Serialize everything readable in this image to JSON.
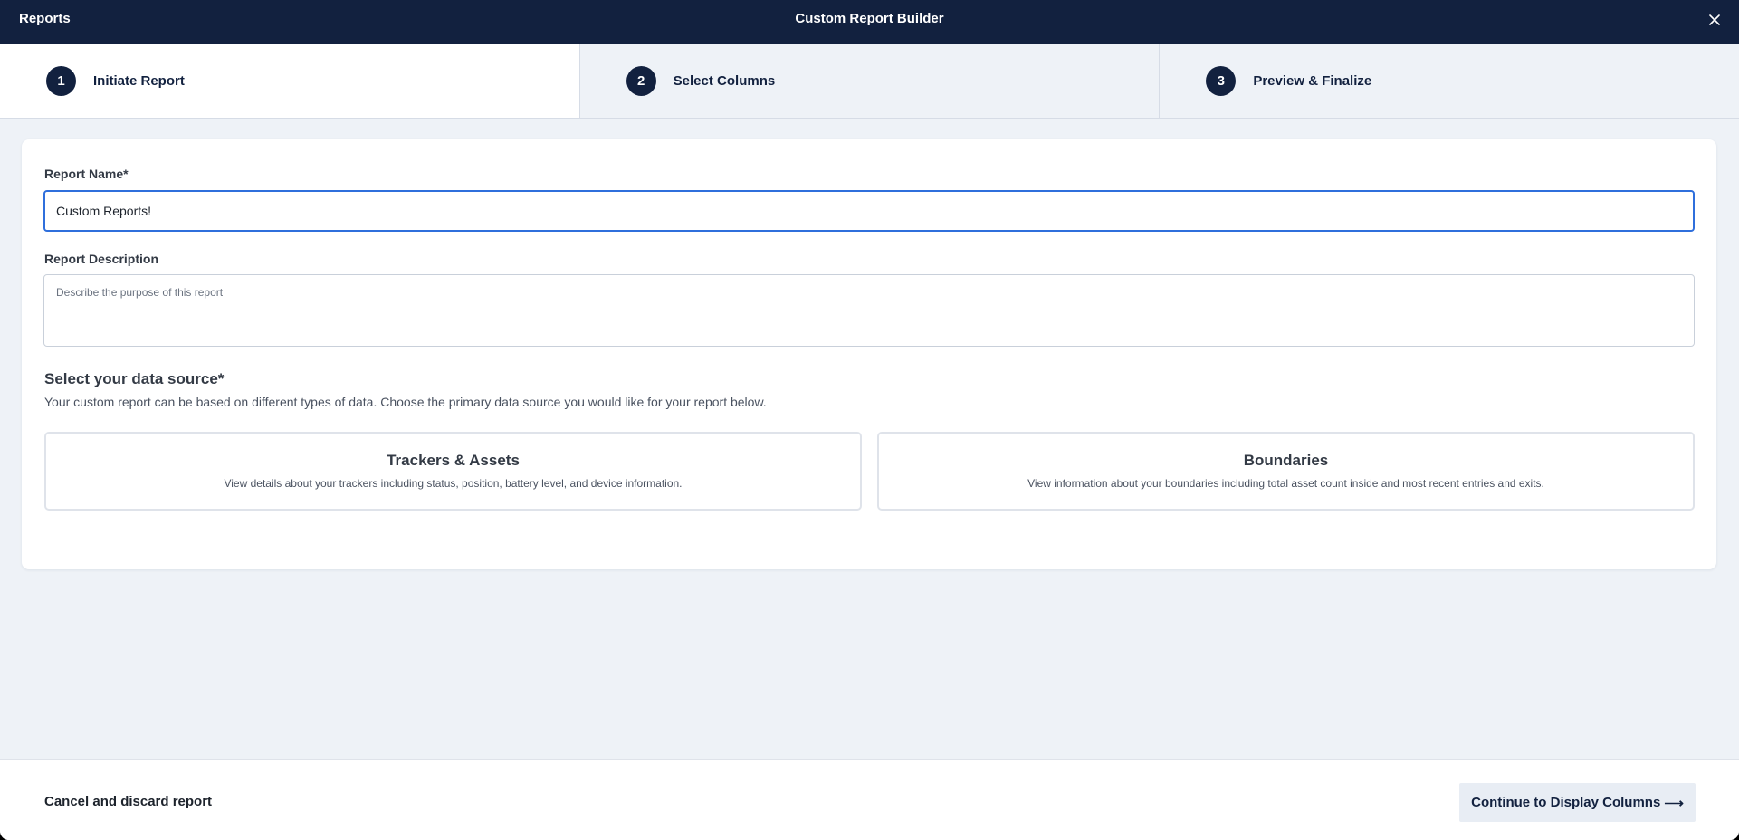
{
  "header": {
    "breadcrumb": "Reports",
    "title": "Custom Report Builder",
    "close_icon": "close-icon"
  },
  "steps": [
    {
      "number": "1",
      "label": "Initiate Report",
      "active": true
    },
    {
      "number": "2",
      "label": "Select Columns",
      "active": false
    },
    {
      "number": "3",
      "label": "Preview & Finalize",
      "active": false
    }
  ],
  "form": {
    "name_label": "Report Name*",
    "name_value": "Custom Reports!",
    "description_label": "Report Description",
    "description_placeholder": "Describe the purpose of this report",
    "description_value": ""
  },
  "data_source": {
    "title": "Select your data source*",
    "help": "Your custom report can be based on different types of data. Choose the primary data source you would like for your report below.",
    "options": [
      {
        "title": "Trackers & Assets",
        "description": "View details about your trackers including status, position, battery level, and device information."
      },
      {
        "title": "Boundaries",
        "description": "View information about your boundaries including total asset count inside and most recent entries and exits."
      }
    ]
  },
  "footer": {
    "cancel_label": "Cancel and discard report",
    "continue_label": "Continue to Display Columns",
    "continue_arrow": "⟶"
  },
  "colors": {
    "header_bg": "#12213f",
    "page_bg": "#eef2f7",
    "focus_border": "#2f6fdc",
    "button_bg": "#e8edf4"
  }
}
